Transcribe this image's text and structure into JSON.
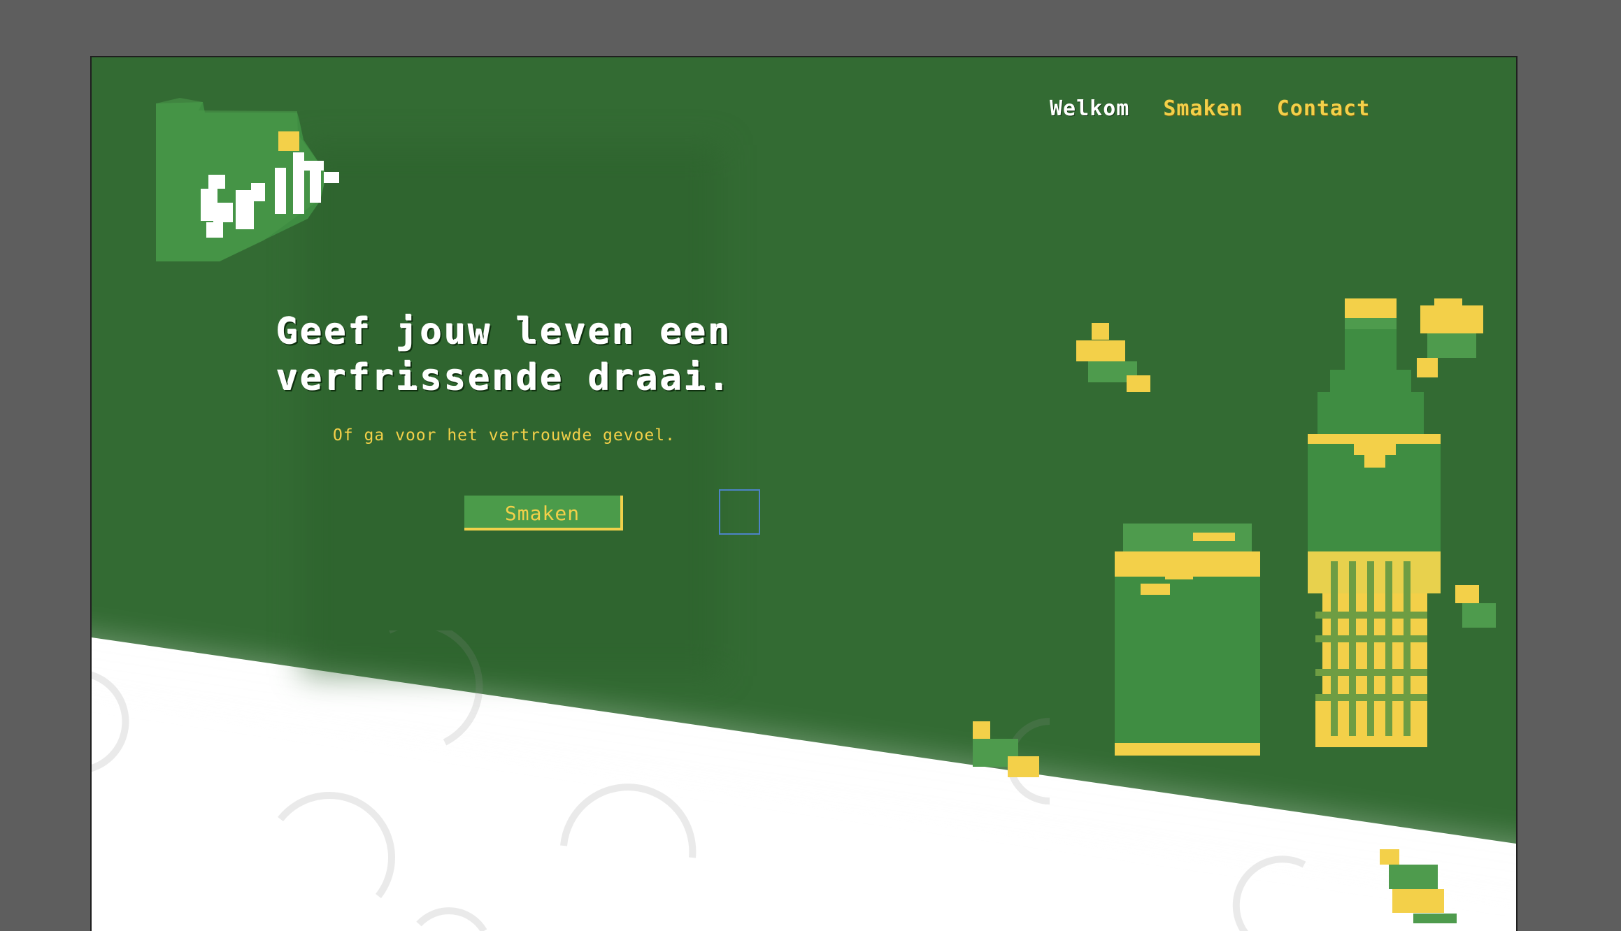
{
  "nav": {
    "items": [
      "Welkom",
      "Smaken",
      "Contact"
    ]
  },
  "hero": {
    "title_line1": "Geef jouw leven een",
    "title_line2": "verfrissende draai.",
    "subtitle": "Of ga voor het vertrouwde gevoel.",
    "button": "Smaken"
  },
  "logo": {
    "text": "Sprite"
  },
  "colors": {
    "dark_green": "#336b33",
    "mid_green": "#4b9b4a",
    "yellow": "#f3d049",
    "white": "#ffffff",
    "outside_canvas": "#5e5e5e"
  },
  "icons": [
    "sprite-logo",
    "lemon-slice-icon",
    "can-icon",
    "bottle-icon",
    "lime-slice-icon"
  ]
}
